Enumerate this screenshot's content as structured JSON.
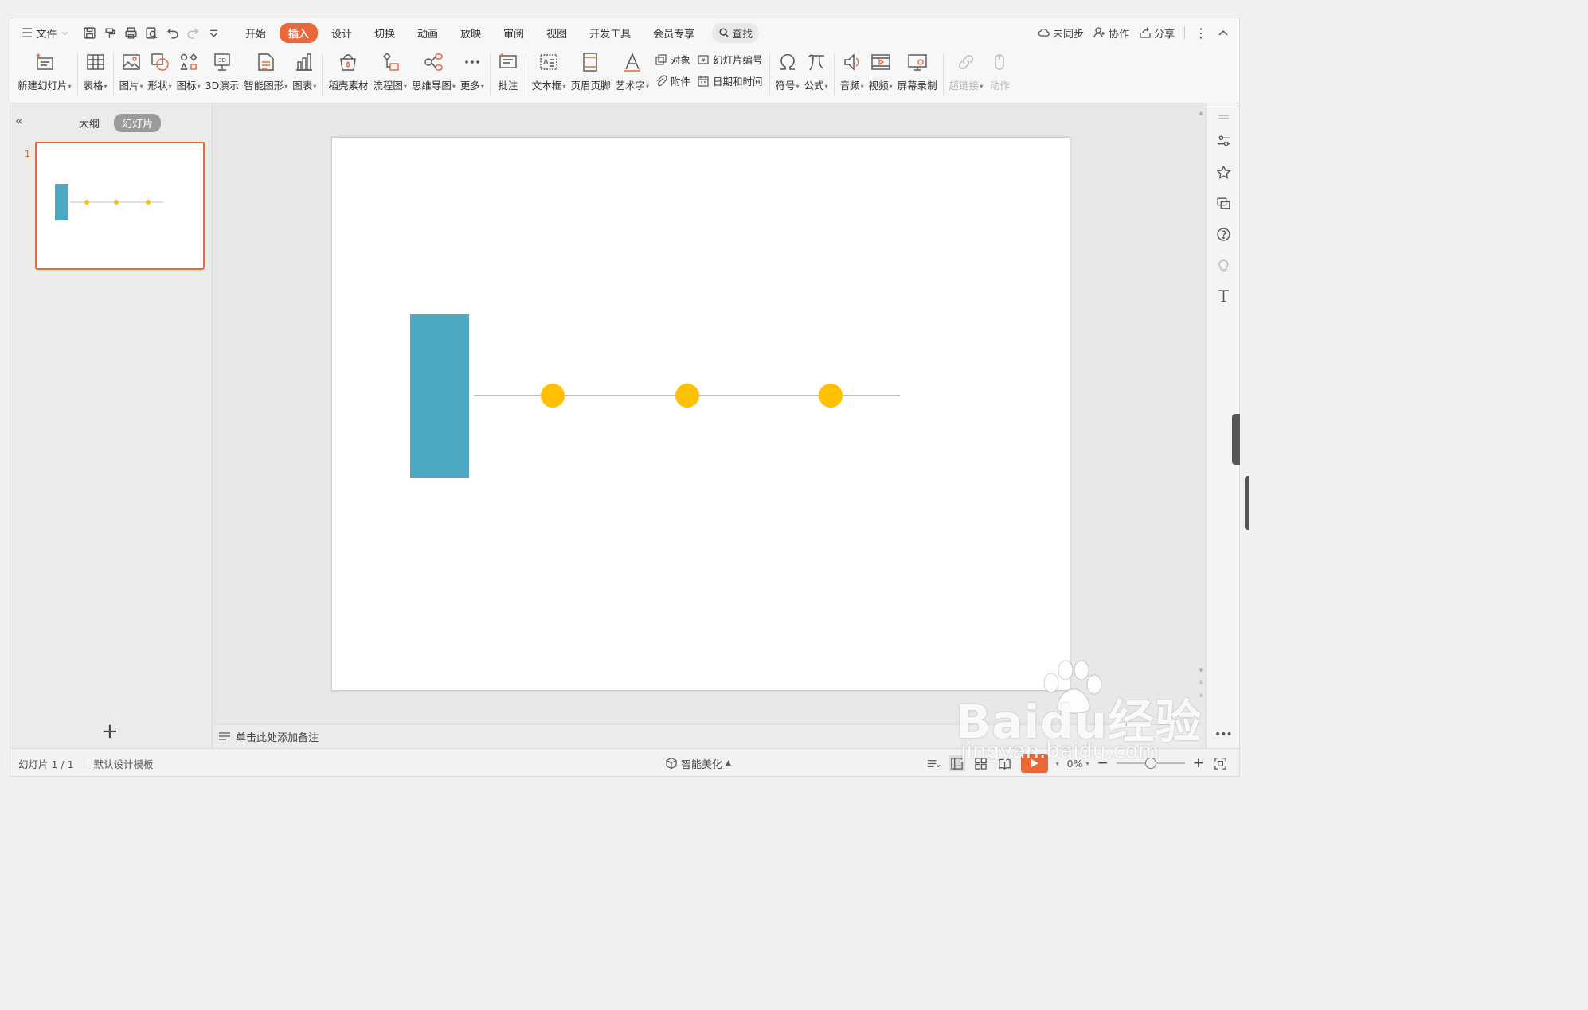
{
  "menubar": {
    "file_label": "文件",
    "tabs": [
      {
        "label": "开始",
        "active": false
      },
      {
        "label": "插入",
        "active": true
      },
      {
        "label": "设计",
        "active": false
      },
      {
        "label": "切换",
        "active": false
      },
      {
        "label": "动画",
        "active": false
      },
      {
        "label": "放映",
        "active": false
      },
      {
        "label": "审阅",
        "active": false
      },
      {
        "label": "视图",
        "active": false
      },
      {
        "label": "开发工具",
        "active": false
      },
      {
        "label": "会员专享",
        "active": false
      }
    ],
    "search_label": "查找",
    "sync_label": "未同步",
    "collab_label": "协作",
    "share_label": "分享"
  },
  "ribbon": {
    "new_slide": "新建幻灯片",
    "table": "表格",
    "picture": "图片",
    "shape": "形状",
    "icon": "图标",
    "demo3d": "3D演示",
    "smart_graphic": "智能图形",
    "chart": "图表",
    "docer_material": "稻壳素材",
    "flowchart": "流程图",
    "mindmap": "思维导图",
    "more": "更多",
    "comment": "批注",
    "textbox": "文本框",
    "header_footer": "页眉页脚",
    "wordart": "艺术字",
    "object": "对象",
    "slide_number": "幻灯片编号",
    "attachment": "附件",
    "datetime": "日期和时间",
    "symbol": "符号",
    "formula": "公式",
    "audio": "音频",
    "video": "视频",
    "screen_record": "屏幕录制",
    "hyperlink": "超链接",
    "action": "动作"
  },
  "leftpanel": {
    "outline_tab": "大纲",
    "slides_tab": "幻灯片",
    "thumb_number": "1"
  },
  "notes": {
    "placeholder": "单击此处添加备注"
  },
  "statusbar": {
    "slide_info": "幻灯片 1 / 1",
    "template": "默认设计模板",
    "beautify": "智能美化",
    "zoom": "0%"
  },
  "watermark": {
    "brand": "Baidu经验",
    "url": "jingyan.baidu.com"
  },
  "slide_content": {
    "rect_color": "#4da9c1",
    "dot_color": "#ffc000",
    "line_color": "#bfbfbf",
    "dot_count": 3
  },
  "colors": {
    "accent": "#e8683a"
  }
}
